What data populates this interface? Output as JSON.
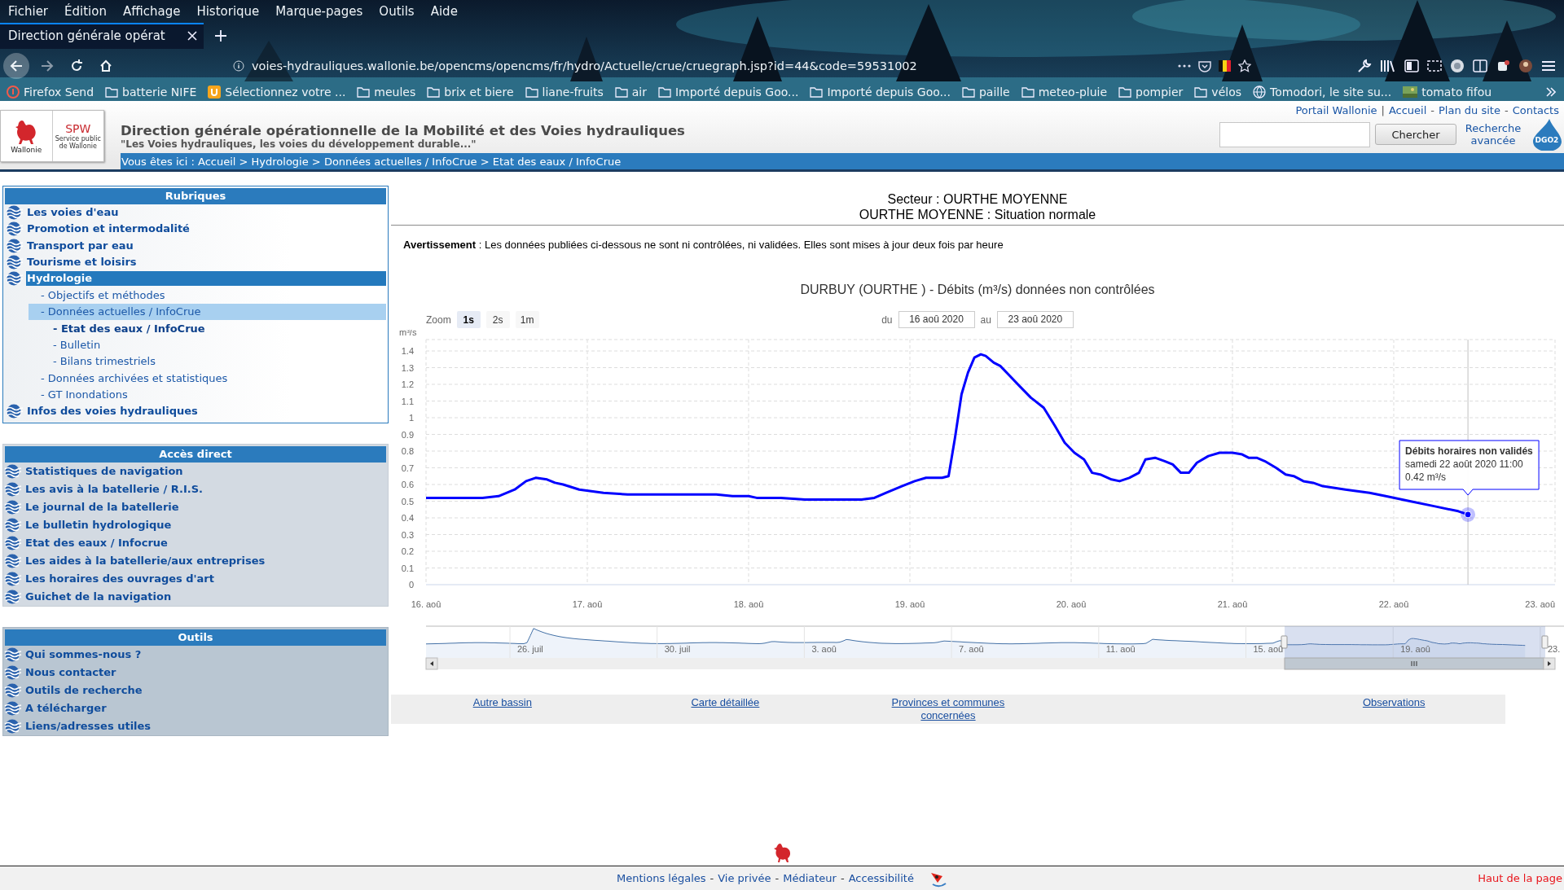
{
  "browser": {
    "menu": [
      "Fichier",
      "Édition",
      "Affichage",
      "Historique",
      "Marque-pages",
      "Outils",
      "Aide"
    ],
    "tabs": [
      {
        "title": "Direction générale opérat",
        "selected": true
      }
    ],
    "url": "voies-hydrauliques.wallonie.be/opencms/opencms/fr/hydro/Actuelle/crue/cruegraph.jsp?id=44&code=59531002",
    "bookmarks": [
      {
        "label": "Firefox Send",
        "kind": "send"
      },
      {
        "label": "batterie NIFE",
        "kind": "folder"
      },
      {
        "label": "Sélectionnez votre ...",
        "kind": "site"
      },
      {
        "label": "meules",
        "kind": "folder"
      },
      {
        "label": "brix et biere",
        "kind": "folder"
      },
      {
        "label": "liane-fruits",
        "kind": "folder"
      },
      {
        "label": "air",
        "kind": "folder"
      },
      {
        "label": "Importé depuis Goo...",
        "kind": "folder"
      },
      {
        "label": "Importé depuis Goo...",
        "kind": "folder"
      },
      {
        "label": "paille",
        "kind": "folder"
      },
      {
        "label": "meteo-pluie",
        "kind": "folder"
      },
      {
        "label": "pompier",
        "kind": "folder"
      },
      {
        "label": "vélos",
        "kind": "folder"
      },
      {
        "label": "Tomodori, le site su...",
        "kind": "globe"
      },
      {
        "label": "tomato fifou"
      }
    ]
  },
  "site": {
    "top_links": [
      {
        "text": "Portail Wallonie",
        "kind": "link"
      },
      {
        "text": "|",
        "kind": "separator"
      },
      {
        "text": "Accueil",
        "kind": "link"
      },
      {
        "text": "-",
        "kind": "separator"
      },
      {
        "text": "Plan du site",
        "kind": "link"
      },
      {
        "text": "-",
        "kind": "separator"
      },
      {
        "text": "Contacts",
        "kind": "link"
      }
    ],
    "logo": {
      "region": "Wallonie",
      "acronym": "SPW",
      "org": "Service public de Wallonie"
    },
    "title": "Direction générale opérationnelle de la Mobilité et des Voies hydrauliques",
    "subtitle": "\"Les Voies hydrauliques, les voies du développement durable...\"",
    "search": {
      "button": "Chercher",
      "advanced": "Recherche avancée",
      "badge": "DGO2"
    },
    "breadcrumb": "Vous êtes ici : Accueil > Hydrologie > Données actuelles / InfoCrue > Etat des eaux / InfoCrue"
  },
  "sidebar": {
    "sections": [
      {
        "title": "Rubriques",
        "kind": "tree",
        "items": [
          {
            "label": "Les voies d'eau",
            "selected": false
          },
          {
            "label": "Promotion et intermodalité",
            "selected": false
          },
          {
            "label": "Transport par eau",
            "selected": false
          },
          {
            "label": "Tourisme et loisirs",
            "selected": false
          },
          {
            "label": "Hydrologie",
            "selected": true,
            "children": [
              {
                "label": "- Objectifs et méthodes",
                "selected": false,
                "current": false
              },
              {
                "label": "- Données actuelles / InfoCrue",
                "selected": true,
                "current": false,
                "children": [
                  {
                    "label": "- Etat des eaux / InfoCrue",
                    "selected": false,
                    "current": true
                  },
                  {
                    "label": "- Bulletin",
                    "selected": false,
                    "current": false
                  },
                  {
                    "label": "- Bilans trimestriels",
                    "selected": false,
                    "current": false
                  }
                ]
              },
              {
                "label": "- Données archivées et statistiques",
                "selected": false,
                "current": false
              },
              {
                "label": "- GT Inondations",
                "selected": false,
                "current": false
              }
            ]
          },
          {
            "label": "Infos des voies hydrauliques",
            "selected": false
          }
        ]
      },
      {
        "title": "Accès direct",
        "kind": "links",
        "items": [
          {
            "label": "Statistiques de navigation"
          },
          {
            "label": "Les avis à la batellerie / R.I.S."
          },
          {
            "label": "Le journal de la batellerie"
          },
          {
            "label": "Le bulletin hydrologique"
          },
          {
            "label": "Etat des eaux / Infocrue"
          },
          {
            "label": "Les aides à la batellerie/aux entreprises"
          },
          {
            "label": "Les horaires des ouvrages d'art"
          },
          {
            "label": "Guichet de la navigation"
          }
        ]
      },
      {
        "title": "Outils",
        "kind": "tools",
        "items": [
          {
            "label": "Qui sommes-nous ?"
          },
          {
            "label": "Nous contacter"
          },
          {
            "label": "Outils de recherche"
          },
          {
            "label": "A télécharger"
          },
          {
            "label": "Liens/adresses utiles"
          }
        ]
      }
    ]
  },
  "sector": {
    "title": "Secteur : OURTHE MOYENNE",
    "status": "OURTHE MOYENNE : Situation normale"
  },
  "warning": "**Avertissement** : Les données publiées ci-dessous ne sont ni contrôlées, ni validées. Elles sont mises à jour deux fois par heure",
  "chart": {
    "zoom_label": "Zoom",
    "zoom_buttons": [
      {
        "label": "1s",
        "selected": true
      },
      {
        "label": "2s",
        "selected": false
      },
      {
        "label": "1m",
        "selected": false
      }
    ],
    "range": {
      "from_label": "du",
      "from": "16 aoû 2020",
      "to_label": "au",
      "to": "23 aoû 2020"
    },
    "chart_data": {
      "type": "line",
      "title": "DURBUY (OURTHE ) - Débits (m³/s) données non contrôlées",
      "ylabel": "m³/s",
      "x": [
        16,
        16.2,
        16.35,
        16.45,
        16.55,
        16.62,
        16.68,
        16.75,
        16.8,
        16.85,
        16.95,
        17.1,
        17.25,
        17.4,
        17.6,
        17.8,
        17.9,
        18.0,
        18.05,
        18.2,
        18.35,
        18.5,
        18.7,
        18.78,
        18.85,
        18.95,
        19.03,
        19.1,
        19.15,
        19.2,
        19.24,
        19.28,
        19.32,
        19.36,
        19.4,
        19.44,
        19.47,
        19.52,
        19.56,
        19.62,
        19.68,
        19.75,
        19.83,
        19.9,
        19.96,
        20.02,
        20.08,
        20.13,
        20.18,
        20.25,
        20.3,
        20.36,
        20.42,
        20.46,
        20.52,
        20.58,
        20.63,
        20.68,
        20.73,
        20.78,
        20.85,
        20.92,
        21.0,
        21.06,
        21.1,
        21.15,
        21.2,
        21.27,
        21.33,
        21.38,
        21.44,
        21.5,
        21.56,
        21.7,
        21.85,
        21.95,
        22.1,
        22.25,
        22.4,
        22.46
      ],
      "series": [
        {
          "name": "Débits horaires non validés",
          "color": "#0000ff",
          "values": [
            0.52,
            0.52,
            0.52,
            0.53,
            0.57,
            0.62,
            0.64,
            0.63,
            0.61,
            0.6,
            0.57,
            0.55,
            0.54,
            0.54,
            0.54,
            0.54,
            0.53,
            0.53,
            0.52,
            0.52,
            0.51,
            0.51,
            0.51,
            0.52,
            0.55,
            0.59,
            0.62,
            0.64,
            0.64,
            0.64,
            0.65,
            0.88,
            1.14,
            1.27,
            1.36,
            1.38,
            1.37,
            1.33,
            1.31,
            1.25,
            1.19,
            1.12,
            1.06,
            0.95,
            0.85,
            0.79,
            0.75,
            0.67,
            0.66,
            0.63,
            0.62,
            0.64,
            0.67,
            0.75,
            0.76,
            0.74,
            0.72,
            0.67,
            0.67,
            0.73,
            0.77,
            0.79,
            0.79,
            0.78,
            0.76,
            0.76,
            0.74,
            0.7,
            0.66,
            0.65,
            0.62,
            0.61,
            0.59,
            0.57,
            0.55,
            0.53,
            0.5,
            0.47,
            0.44,
            0.42
          ]
        }
      ],
      "xlim": [
        16,
        23
      ],
      "ylim": [
        0,
        1.4
      ],
      "grid": true,
      "ref_lines": [
        {
          "axis": "x",
          "value": 22.46
        }
      ],
      "xticks": [
        {
          "value": 16,
          "label": "16. aoû"
        },
        {
          "value": 17,
          "label": "17. aoû"
        },
        {
          "value": 18,
          "label": "18. aoû"
        },
        {
          "value": 19,
          "label": "19. aoû"
        },
        {
          "value": 20,
          "label": "20. aoû"
        },
        {
          "value": 21,
          "label": "21. aoû"
        },
        {
          "value": 22,
          "label": "22. aoû"
        },
        {
          "value": 23,
          "label": "23. aoû"
        }
      ],
      "yticks": [
        0,
        0.1,
        0.2,
        0.3,
        0.4,
        0.5,
        0.6,
        0.7,
        0.8,
        0.9,
        1,
        1.1,
        1.2,
        1.3,
        1.4
      ]
    },
    "tooltip": {
      "date": "samedi 22 août 2020 11:00",
      "value": "0.42 m³/s"
    },
    "navigator": {
      "labels": [
        "26. juil",
        "30. juil",
        "3. aoû",
        "7. aoû",
        "11. aoû",
        "15. aoû",
        "19. aoû",
        "23."
      ]
    }
  },
  "links": [
    "Autre bassin",
    "Carte détaillée",
    "Provinces et communes concernées",
    "Observations"
  ],
  "footer": {
    "links": [
      {
        "text": "Mentions légales",
        "kind": "link"
      },
      {
        "text": "-",
        "kind": "separator"
      },
      {
        "text": "Vie privée",
        "kind": "link"
      },
      {
        "text": "-",
        "kind": "separator"
      },
      {
        "text": "Médiateur",
        "kind": "link"
      },
      {
        "text": "-",
        "kind": "separator"
      },
      {
        "text": "Accessibilité",
        "kind": "link"
      }
    ],
    "top_link": "Haut de la page"
  }
}
